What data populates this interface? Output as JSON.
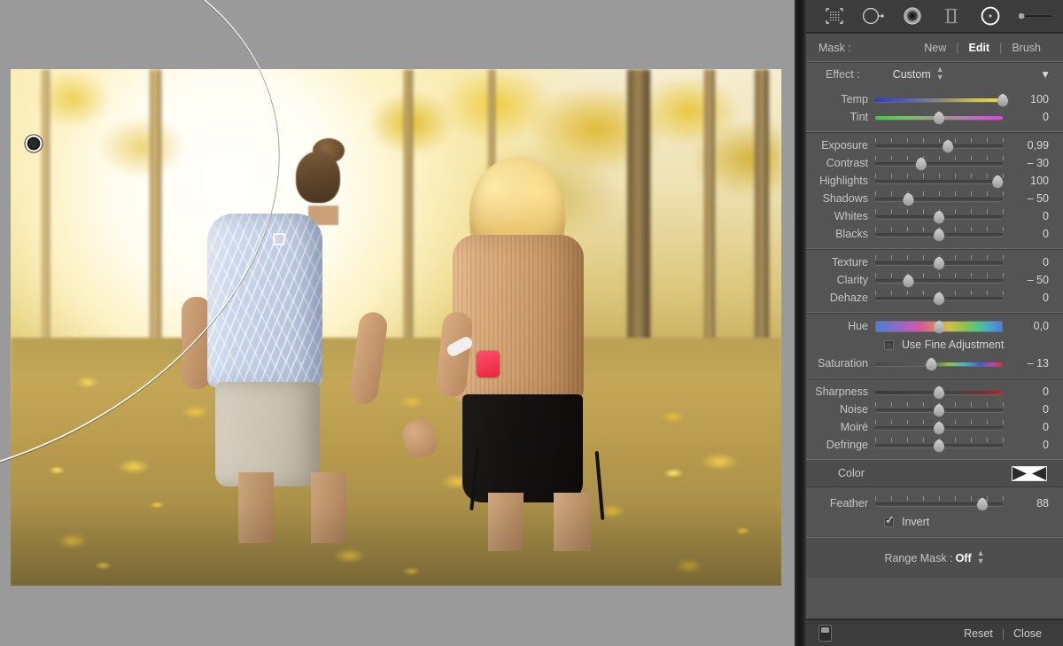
{
  "toolstrip": {
    "tools": [
      {
        "name": "select-subject-icon",
        "label": "Select Subject"
      },
      {
        "name": "radial-gradient-tool-icon",
        "label": "Radial Gradient"
      },
      {
        "name": "color-range-tool-icon",
        "label": "Color Range"
      },
      {
        "name": "linear-gradient-tool-icon",
        "label": "Linear Gradient"
      },
      {
        "name": "brush-tool-icon",
        "label": "Brush"
      }
    ],
    "size_slider": {
      "label": "Size",
      "value": 0
    }
  },
  "mask_row": {
    "label": "Mask :",
    "tabs": [
      {
        "label": "New",
        "active": false
      },
      {
        "label": "Edit",
        "active": true
      },
      {
        "label": "Brush",
        "active": false
      }
    ],
    "divider": "|"
  },
  "effect_row": {
    "label": "Effect :",
    "value": "Custom",
    "caret": "▼"
  },
  "groups": [
    {
      "name": "white-balance",
      "sliders": [
        {
          "name": "Temp",
          "value": "100",
          "pos": 100,
          "gradient": "grad-temp"
        },
        {
          "name": "Tint",
          "value": "0",
          "pos": 50,
          "gradient": "grad-tint"
        }
      ]
    },
    {
      "name": "tone",
      "sliders": [
        {
          "name": "Exposure",
          "value": "0,99",
          "pos": 57,
          "gradient": ""
        },
        {
          "name": "Contrast",
          "value": "– 30",
          "pos": 36,
          "gradient": ""
        },
        {
          "name": "Highlights",
          "value": "100",
          "pos": 96,
          "gradient": ""
        },
        {
          "name": "Shadows",
          "value": "– 50",
          "pos": 26,
          "gradient": ""
        },
        {
          "name": "Whites",
          "value": "0",
          "pos": 50,
          "gradient": ""
        },
        {
          "name": "Blacks",
          "value": "0",
          "pos": 50,
          "gradient": ""
        }
      ]
    },
    {
      "name": "presence",
      "sliders": [
        {
          "name": "Texture",
          "value": "0",
          "pos": 50,
          "gradient": ""
        },
        {
          "name": "Clarity",
          "value": "– 50",
          "pos": 26,
          "gradient": ""
        },
        {
          "name": "Dehaze",
          "value": "0",
          "pos": 50,
          "gradient": ""
        }
      ]
    },
    {
      "name": "color",
      "sliders": [
        {
          "name": "Saturation",
          "value": "– 13",
          "pos": 44,
          "gradient": "grad-sat"
        }
      ]
    },
    {
      "name": "detail",
      "sliders": [
        {
          "name": "Sharpness",
          "value": "0",
          "pos": 50,
          "gradient": "grad-sharp"
        },
        {
          "name": "Noise",
          "value": "0",
          "pos": 50,
          "gradient": ""
        },
        {
          "name": "Moiré",
          "value": "0",
          "pos": 50,
          "gradient": ""
        },
        {
          "name": "Defringe",
          "value": "0",
          "pos": 50,
          "gradient": ""
        }
      ]
    }
  ],
  "hue": {
    "name": "Hue",
    "value": "0,0",
    "pos": 50
  },
  "fine_adjust": {
    "label": "Use Fine Adjustment",
    "checked": false
  },
  "color_row": {
    "label": "Color",
    "swatch": "none"
  },
  "feather": {
    "name": "Feather",
    "value": "88",
    "pos": 84
  },
  "invert": {
    "label": "Invert",
    "checked": true
  },
  "range_mask": {
    "label": "Range Mask :",
    "value": "Off"
  },
  "footer": {
    "filmstrip_icon": "filmstrip-icon",
    "reset_label": "Reset",
    "divider": "|",
    "close_label": "Close"
  },
  "canvas": {
    "overlay_type": "radial-gradient-mask",
    "pin_label": "mask-pin"
  }
}
